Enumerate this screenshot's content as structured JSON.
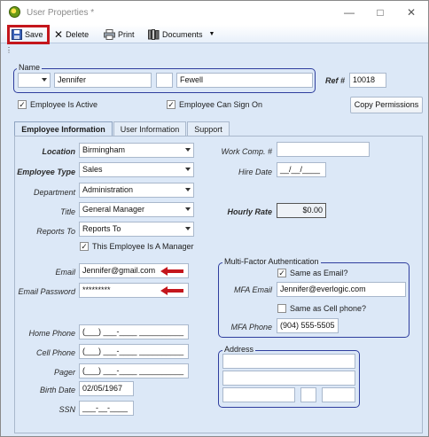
{
  "window": {
    "title": "User Properties *"
  },
  "toolbar": {
    "save": "Save",
    "delete": "Delete",
    "print": "Print",
    "documents": "Documents"
  },
  "name_group": {
    "label": "Name",
    "prefix": "",
    "first": "Jennifer",
    "middle": "",
    "last": "Fewell"
  },
  "ref": {
    "label": "Ref #",
    "value": "10018"
  },
  "checks": {
    "active": {
      "label": "Employee Is Active",
      "checked": true
    },
    "signon": {
      "label": "Employee Can Sign On",
      "checked": true
    }
  },
  "copy_permissions": "Copy Permissions",
  "tabs": [
    "Employee Information",
    "User Information",
    "Support"
  ],
  "employee": {
    "location": {
      "label": "Location",
      "value": "Birmingham"
    },
    "employee_type": {
      "label": "Employee Type",
      "value": "Sales"
    },
    "department": {
      "label": "Department",
      "value": "Administration"
    },
    "title": {
      "label": "Title",
      "value": "General Manager"
    },
    "reports_to": {
      "label": "Reports To",
      "value": "Reports To"
    },
    "manager": {
      "label": "This Employee Is A Manager",
      "checked": true
    },
    "email": {
      "label": "Email",
      "value": "Jennifer@gmail.com"
    },
    "email_password": {
      "label": "Email Password",
      "value": "*********"
    },
    "home_phone": {
      "label": "Home Phone",
      "value": "(___) ___-____ __________"
    },
    "cell_phone": {
      "label": "Cell Phone",
      "value": "(___) ___-____ __________"
    },
    "pager": {
      "label": "Pager",
      "value": "(___) ___-____ __________"
    },
    "birth_date": {
      "label": "Birth Date",
      "value": "02/05/1967"
    },
    "ssn": {
      "label": "SSN",
      "value": "___-__-____"
    },
    "work_comp": {
      "label": "Work Comp. #",
      "value": ""
    },
    "hire_date": {
      "label": "Hire Date",
      "value": "__/__/____"
    },
    "hourly_rate": {
      "label": "Hourly Rate",
      "value": "$0.00"
    }
  },
  "mfa": {
    "title": "Multi-Factor Authentication",
    "same_as_email": {
      "label": "Same as Email?",
      "checked": true
    },
    "mfa_email": {
      "label": "MFA Email",
      "value": "Jennifer@everlogic.com"
    },
    "same_as_cell": {
      "label": "Same as Cell phone?",
      "checked": false
    },
    "mfa_phone": {
      "label": "MFA Phone",
      "value": "(904) 555-5505"
    }
  },
  "address": {
    "title": "Address"
  },
  "colors": {
    "accent_border": "#2f3e9e",
    "highlight_red": "#c4161c",
    "panel_bg": "#dce8f7"
  }
}
